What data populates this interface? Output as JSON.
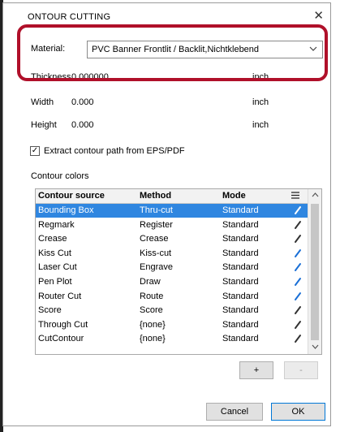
{
  "dialog": {
    "title": "ONTOUR CUTTING",
    "close_glyph": "✕"
  },
  "material": {
    "label": "Material:",
    "value": "PVC Banner Frontlit / Backlit,Nichtklebend",
    "chevron_icon": "chevron-down-icon"
  },
  "dimensions": {
    "thickness_label": "Thickness",
    "thickness_value": "0.000000",
    "thickness_unit": "inch",
    "width_label": "Width",
    "width_value": "0.000",
    "width_unit": "inch",
    "height_label": "Height",
    "height_value": "0.000",
    "height_unit": "inch"
  },
  "extract": {
    "label": "Extract contour path from EPS/PDF",
    "checked": true
  },
  "contour_colors": {
    "section_label": "Contour colors",
    "columns": [
      "Contour source",
      "Method",
      "Mode"
    ],
    "menu_icon": "hamburger-menu-icon",
    "rows": [
      {
        "source": "Bounding Box",
        "method": "Thru-cut",
        "mode": "Standard",
        "pen_color": "#ffffff",
        "selected": true
      },
      {
        "source": "Regmark",
        "method": "Register",
        "mode": "Standard",
        "pen_color": "#333333"
      },
      {
        "source": "Crease",
        "method": "Crease",
        "mode": "Standard",
        "pen_color": "#333333"
      },
      {
        "source": "Kiss Cut",
        "method": "Kiss-cut",
        "mode": "Standard",
        "pen_color": "#1a6fd6"
      },
      {
        "source": "Laser Cut",
        "method": "Engrave",
        "mode": "Standard",
        "pen_color": "#1a6fd6"
      },
      {
        "source": "Pen Plot",
        "method": "Draw",
        "mode": "Standard",
        "pen_color": "#1a6fd6"
      },
      {
        "source": "Router Cut",
        "method": "Route",
        "mode": "Standard",
        "pen_color": "#1a6fd6"
      },
      {
        "source": "Score",
        "method": "Score",
        "mode": "Standard",
        "pen_color": "#333333"
      },
      {
        "source": "Through Cut",
        "method": "{none}",
        "mode": "Standard",
        "pen_color": "#333333"
      },
      {
        "source": "CutContour",
        "method": "{none}",
        "mode": "Standard",
        "pen_color": "#333333"
      }
    ]
  },
  "buttons": {
    "add": "+",
    "remove": "-",
    "cancel": "Cancel",
    "ok": "OK"
  },
  "accent": "#2f86e0",
  "highlight_color": "#b0102a"
}
